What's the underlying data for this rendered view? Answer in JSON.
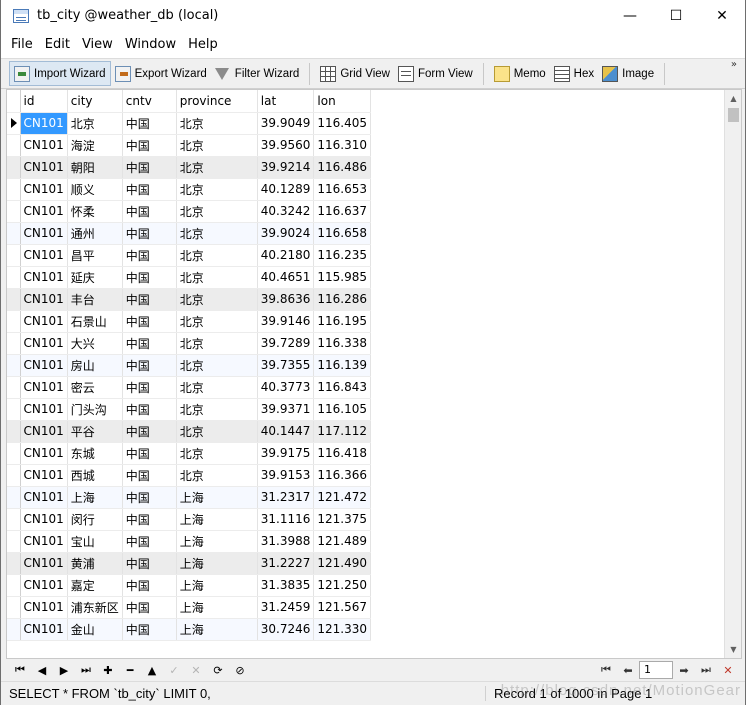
{
  "window": {
    "title": "tb_city @weather_db (local)",
    "controls": {
      "minimize": "—",
      "maximize": "☐",
      "close": "✕"
    }
  },
  "menu": [
    "File",
    "Edit",
    "View",
    "Window",
    "Help"
  ],
  "toolbar": {
    "import_wizard": "Import Wizard",
    "export_wizard": "Export Wizard",
    "filter_wizard": "Filter Wizard",
    "grid_view": "Grid View",
    "form_view": "Form View",
    "memo": "Memo",
    "hex": "Hex",
    "image": "Image",
    "more": "»"
  },
  "grid": {
    "columns": [
      "id",
      "city",
      "cntv",
      "province",
      "lat",
      "lon"
    ],
    "rows": [
      [
        "CN101",
        "北京",
        "中国",
        "北京",
        "39.9049",
        "116.405"
      ],
      [
        "CN101",
        "海淀",
        "中国",
        "北京",
        "39.9560",
        "116.310"
      ],
      [
        "CN101",
        "朝阳",
        "中国",
        "北京",
        "39.9214",
        "116.486"
      ],
      [
        "CN101",
        "顺义",
        "中国",
        "北京",
        "40.1289",
        "116.653"
      ],
      [
        "CN101",
        "怀柔",
        "中国",
        "北京",
        "40.3242",
        "116.637"
      ],
      [
        "CN101",
        "通州",
        "中国",
        "北京",
        "39.9024",
        "116.658"
      ],
      [
        "CN101",
        "昌平",
        "中国",
        "北京",
        "40.2180",
        "116.235"
      ],
      [
        "CN101",
        "延庆",
        "中国",
        "北京",
        "40.4651",
        "115.985"
      ],
      [
        "CN101",
        "丰台",
        "中国",
        "北京",
        "39.8636",
        "116.286"
      ],
      [
        "CN101",
        "石景山",
        "中国",
        "北京",
        "39.9146",
        "116.195"
      ],
      [
        "CN101",
        "大兴",
        "中国",
        "北京",
        "39.7289",
        "116.338"
      ],
      [
        "CN101",
        "房山",
        "中国",
        "北京",
        "39.7355",
        "116.139"
      ],
      [
        "CN101",
        "密云",
        "中国",
        "北京",
        "40.3773",
        "116.843"
      ],
      [
        "CN101",
        "门头沟",
        "中国",
        "北京",
        "39.9371",
        "116.105"
      ],
      [
        "CN101",
        "平谷",
        "中国",
        "北京",
        "40.1447",
        "117.112"
      ],
      [
        "CN101",
        "东城",
        "中国",
        "北京",
        "39.9175",
        "116.418"
      ],
      [
        "CN101",
        "西城",
        "中国",
        "北京",
        "39.9153",
        "116.366"
      ],
      [
        "CN101",
        "上海",
        "中国",
        "上海",
        "31.2317",
        "121.472"
      ],
      [
        "CN101",
        "闵行",
        "中国",
        "上海",
        "31.1116",
        "121.375"
      ],
      [
        "CN101",
        "宝山",
        "中国",
        "上海",
        "31.3988",
        "121.489"
      ],
      [
        "CN101",
        "黄浦",
        "中国",
        "上海",
        "31.2227",
        "121.490"
      ],
      [
        "CN101",
        "嘉定",
        "中国",
        "上海",
        "31.3835",
        "121.250"
      ],
      [
        "CN101",
        "浦东新区",
        "中国",
        "上海",
        "31.2459",
        "121.567"
      ],
      [
        "CN101",
        "金山",
        "中国",
        "上海",
        "30.7246",
        "121.330"
      ]
    ],
    "alt_rows": [
      5,
      11,
      17,
      23
    ],
    "shaded_rows": [
      2,
      8,
      14,
      20
    ],
    "selected_row": 0,
    "accent": "#3399ff"
  },
  "nav": {
    "buttons": [
      {
        "name": "first-record-icon",
        "glyph": "⏮",
        "disabled": false
      },
      {
        "name": "prev-record-icon",
        "glyph": "◀",
        "disabled": false
      },
      {
        "name": "next-record-icon",
        "glyph": "▶",
        "disabled": false
      },
      {
        "name": "last-record-icon",
        "glyph": "⏭",
        "disabled": false
      },
      {
        "name": "add-record-icon",
        "glyph": "✚",
        "disabled": false
      },
      {
        "name": "delete-record-icon",
        "glyph": "━",
        "disabled": false
      },
      {
        "name": "up-icon",
        "glyph": "▲",
        "disabled": false
      },
      {
        "name": "apply-icon",
        "glyph": "✓",
        "disabled": true
      },
      {
        "name": "discard-icon",
        "glyph": "✕",
        "disabled": true
      },
      {
        "name": "refresh-icon",
        "glyph": "⟳",
        "disabled": false
      },
      {
        "name": "stop-icon",
        "glyph": "⊘",
        "disabled": false
      }
    ],
    "page_value": "1"
  },
  "status": {
    "sql": "SELECT * FROM `tb_city` LIMIT 0,",
    "record": "Record 1 of 1000 in Page 1"
  },
  "watermark": "http://blog.csdn.net/MotionGear"
}
